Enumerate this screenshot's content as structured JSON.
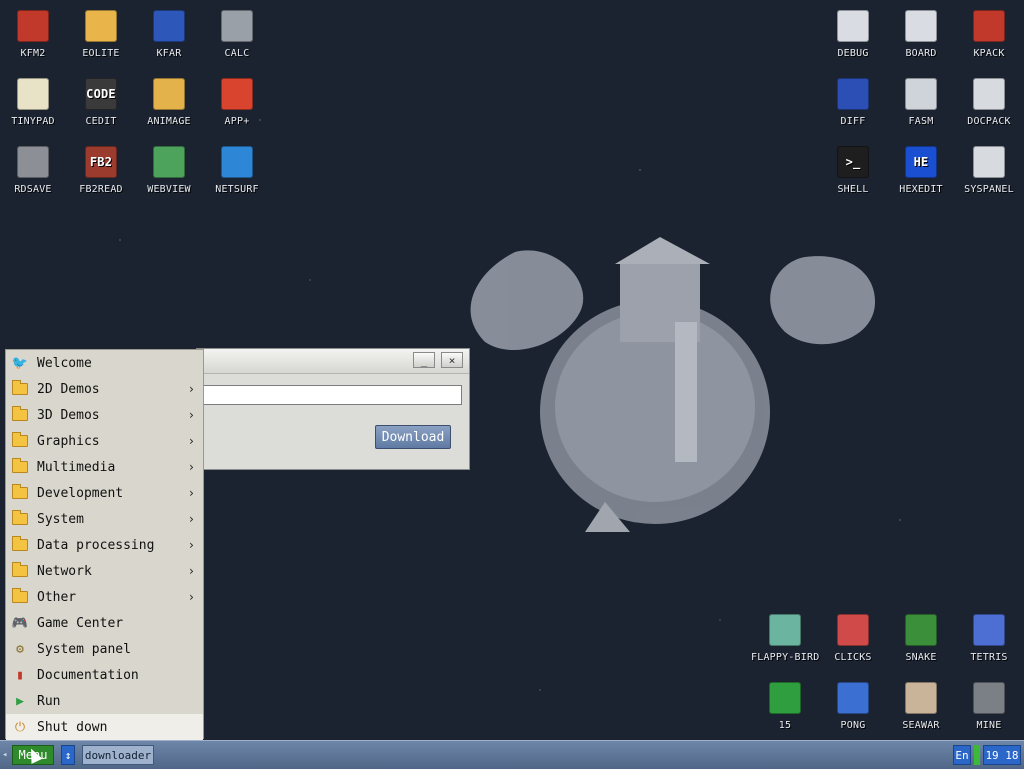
{
  "desktop_left": [
    {
      "label": "KFM2",
      "icon": "floppy-disk-icon",
      "color": "#c0392b"
    },
    {
      "label": "EOLITE",
      "icon": "folder-icon",
      "color": "#e9b54a"
    },
    {
      "label": "KFAR",
      "icon": "file-manager-icon",
      "color": "#2d57b8"
    },
    {
      "label": "CALC",
      "icon": "calculator-icon",
      "color": "#9aa0a8"
    },
    {
      "label": "TINYPAD",
      "icon": "notepad-icon",
      "color": "#e8e2c6"
    },
    {
      "label": "CEDIT",
      "icon": "code-editor-icon",
      "color": "#3a3a3a",
      "glyph": "CODE"
    },
    {
      "label": "ANIMAGE",
      "icon": "paint-tools-icon",
      "color": "#e3b24a"
    },
    {
      "label": "APP+",
      "icon": "rubik-cube-icon",
      "color": "#d9442f"
    },
    {
      "label": "RDSAVE",
      "icon": "ram-disk-icon",
      "color": "#8c8f96"
    },
    {
      "label": "FB2READ",
      "icon": "book-icon",
      "color": "#9b3b2e",
      "glyph": "FB2"
    },
    {
      "label": "WEBVIEW",
      "icon": "globe-map-icon",
      "color": "#4da35c"
    },
    {
      "label": "NETSURF",
      "icon": "network-globe-icon",
      "color": "#2d86d6"
    }
  ],
  "desktop_right": [
    {
      "label": "DEBUG",
      "icon": "bug-icon",
      "color": "#d9dde3"
    },
    {
      "label": "BOARD",
      "icon": "clipboard-icon",
      "color": "#d9dde3"
    },
    {
      "label": "KPACK",
      "icon": "wrench-icon",
      "color": "#c0392b"
    },
    {
      "label": "DIFF",
      "icon": "diff-grid-icon",
      "color": "#2b4fb5"
    },
    {
      "label": "FASM",
      "icon": "assembler-icon",
      "color": "#cfd4da"
    },
    {
      "label": "DOCPACK",
      "icon": "cabinet-icon",
      "color": "#d7dbe0"
    },
    {
      "label": "SHELL",
      "icon": "terminal-icon",
      "color": "#1e1e1e",
      "glyph": ">_"
    },
    {
      "label": "HEXEDIT",
      "icon": "hex-editor-icon",
      "color": "#1b4fd1",
      "glyph": "HE"
    },
    {
      "label": "SYSPANEL",
      "icon": "sliders-icon",
      "color": "#d7dbe0"
    }
  ],
  "desktop_games": [
    {
      "label": "FLAPPY-BIRD",
      "icon": "bird-icon",
      "color": "#6bb5a0"
    },
    {
      "label": "CLICKS",
      "icon": "blocks-icon",
      "color": "#d04a4a"
    },
    {
      "label": "SNAKE",
      "icon": "snake-icon",
      "color": "#3b8f3b"
    },
    {
      "label": "TETRIS",
      "icon": "tetris-icon",
      "color": "#4d6fd3"
    },
    {
      "label": "15",
      "icon": "fifteen-puzzle-icon",
      "color": "#2e9e3e"
    },
    {
      "label": "PONG",
      "icon": "pong-icon",
      "color": "#3b6fd1"
    },
    {
      "label": "SEAWAR",
      "icon": "ship-icon",
      "color": "#c9b49a"
    },
    {
      "label": "MINE",
      "icon": "mine-icon",
      "color": "#7b7f86"
    }
  ],
  "window": {
    "url_value": "",
    "download_label": "Download",
    "minimize_label": "_",
    "close_label": "×"
  },
  "menu": {
    "items": [
      {
        "label": "Welcome",
        "icon": "bird-icon",
        "submenu": false
      },
      {
        "label": "2D Demos",
        "icon": "folder-icon",
        "submenu": true
      },
      {
        "label": "3D Demos",
        "icon": "folder-icon",
        "submenu": true
      },
      {
        "label": "Graphics",
        "icon": "folder-icon",
        "submenu": true
      },
      {
        "label": "Multimedia",
        "icon": "folder-icon",
        "submenu": true
      },
      {
        "label": "Development",
        "icon": "folder-icon",
        "submenu": true
      },
      {
        "label": "System",
        "icon": "folder-icon",
        "submenu": true
      },
      {
        "label": "Data processing",
        "icon": "folder-icon",
        "submenu": true
      },
      {
        "label": "Network",
        "icon": "folder-icon",
        "submenu": true
      },
      {
        "label": "Other",
        "icon": "folder-icon",
        "submenu": true
      },
      {
        "label": "Game Center",
        "icon": "gamepad-icon",
        "submenu": false
      },
      {
        "label": "System panel",
        "icon": "gears-icon",
        "submenu": false
      },
      {
        "label": "Documentation",
        "icon": "books-icon",
        "submenu": false
      },
      {
        "label": "Run",
        "icon": "play-icon",
        "submenu": false
      },
      {
        "label": "Shut down",
        "icon": "power-icon",
        "submenu": false
      }
    ],
    "arrow": "›"
  },
  "taskbar": {
    "menu_label": "Menu",
    "swap_label": "↕",
    "task_label": "downloader",
    "lang_label": "En",
    "clock": "19 18",
    "left_arrow": "◂"
  }
}
